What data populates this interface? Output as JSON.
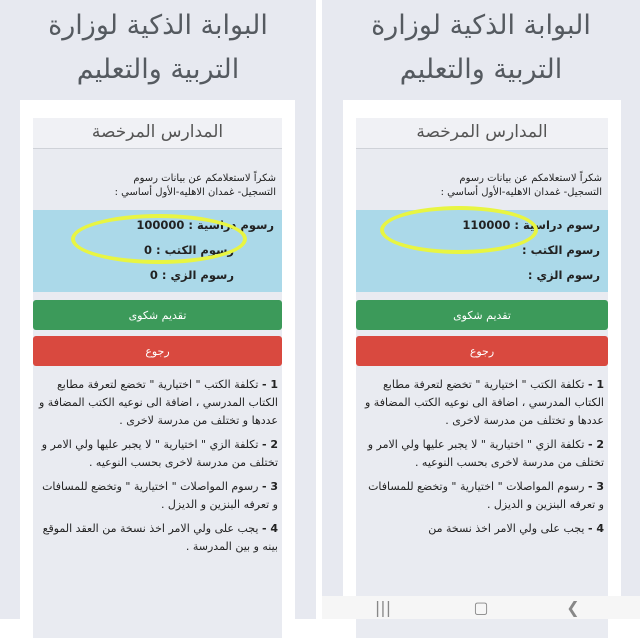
{
  "left": {
    "header_line1": "البوابة الذكية لوزارة",
    "header_line2": "التربية والتعليم",
    "card_title": "المدارس المرخصة",
    "intro_line1": "شكراً لاستعلامكم عن بيانات رسوم",
    "intro_line2": "التسجيل- غمدان الاهليه-الأول أساسي :",
    "fee_tuition": "رسوم دراسية : 100000",
    "fee_books": "رسوم الكتب : 0",
    "fee_uniform": "رسوم الزي : 0",
    "complaint_label": "تقديم شكوى",
    "back_label": "رجوع",
    "notes": [
      {
        "num": "1 -",
        "text": "تكلفة الكتب \" اختيارية \" تخضع لتعرفة مطابع الكتاب المدرسي ، اضافة الى نوعيه الكتب المضافة و عددها و تختلف من مدرسة لاخرى ."
      },
      {
        "num": "2 -",
        "text": "تكلفة الزي \" اختيارية \" لا يجبر عليها ولي الامر و تختلف من مدرسة لاخرى بحسب النوعيه ."
      },
      {
        "num": "3 -",
        "text": "رسوم المواصلات \" اختيارية \" وتخضع للمسافات و تعرفه البنزين و الديزل ."
      },
      {
        "num": "4 -",
        "text": "يجب على ولي الامر اخذ نسخة من العقد الموقع بينه و بين المدرسة ."
      }
    ]
  },
  "right": {
    "header_line1": "البوابة الذكية لوزارة",
    "header_line2": "التربية والتعليم",
    "card_title": "المدارس المرخصة",
    "intro_line1": "شكراً لاستعلامكم عن بيانات رسوم",
    "intro_line2": "التسجيل- غمدان الاهليه-الأول أساسي :",
    "fee_tuition": "رسوم دراسية : 110000",
    "fee_books": "رسوم الكتب :",
    "fee_uniform": "رسوم الزي :",
    "complaint_label": "تقديم شكوى",
    "back_label": "رجوع",
    "notes": [
      {
        "num": "1 -",
        "text": "تكلفة الكتب \" اختيارية \" تخضع لتعرفة مطابع الكتاب المدرسي ، اضافة الى نوعيه الكتب المضافة و عددها و تختلف من مدرسة لاخرى ."
      },
      {
        "num": "2 -",
        "text": "تكلفة الزي \" اختيارية \" لا يجبر عليها ولي الامر و تختلف من مدرسة لاخرى بحسب النوعيه ."
      },
      {
        "num": "3 -",
        "text": "رسوم المواصلات \" اختيارية \" وتخضع للمسافات و تعرفه البنزين و الديزل ."
      },
      {
        "num": "4 -",
        "text": "يجب على ولي الامر اخذ نسخة من"
      }
    ]
  },
  "navbar": {
    "recent_icon": "recent-apps-icon",
    "home_icon": "home-icon",
    "back_icon": "back-icon",
    "recent_glyph": "|||",
    "home_glyph": "▢",
    "back_glyph": "❯"
  },
  "colors": {
    "highlight": "#e8f542",
    "fees_bg": "#abd9e9",
    "complaint_btn": "#3c9a5a",
    "back_btn": "#d9493f"
  }
}
